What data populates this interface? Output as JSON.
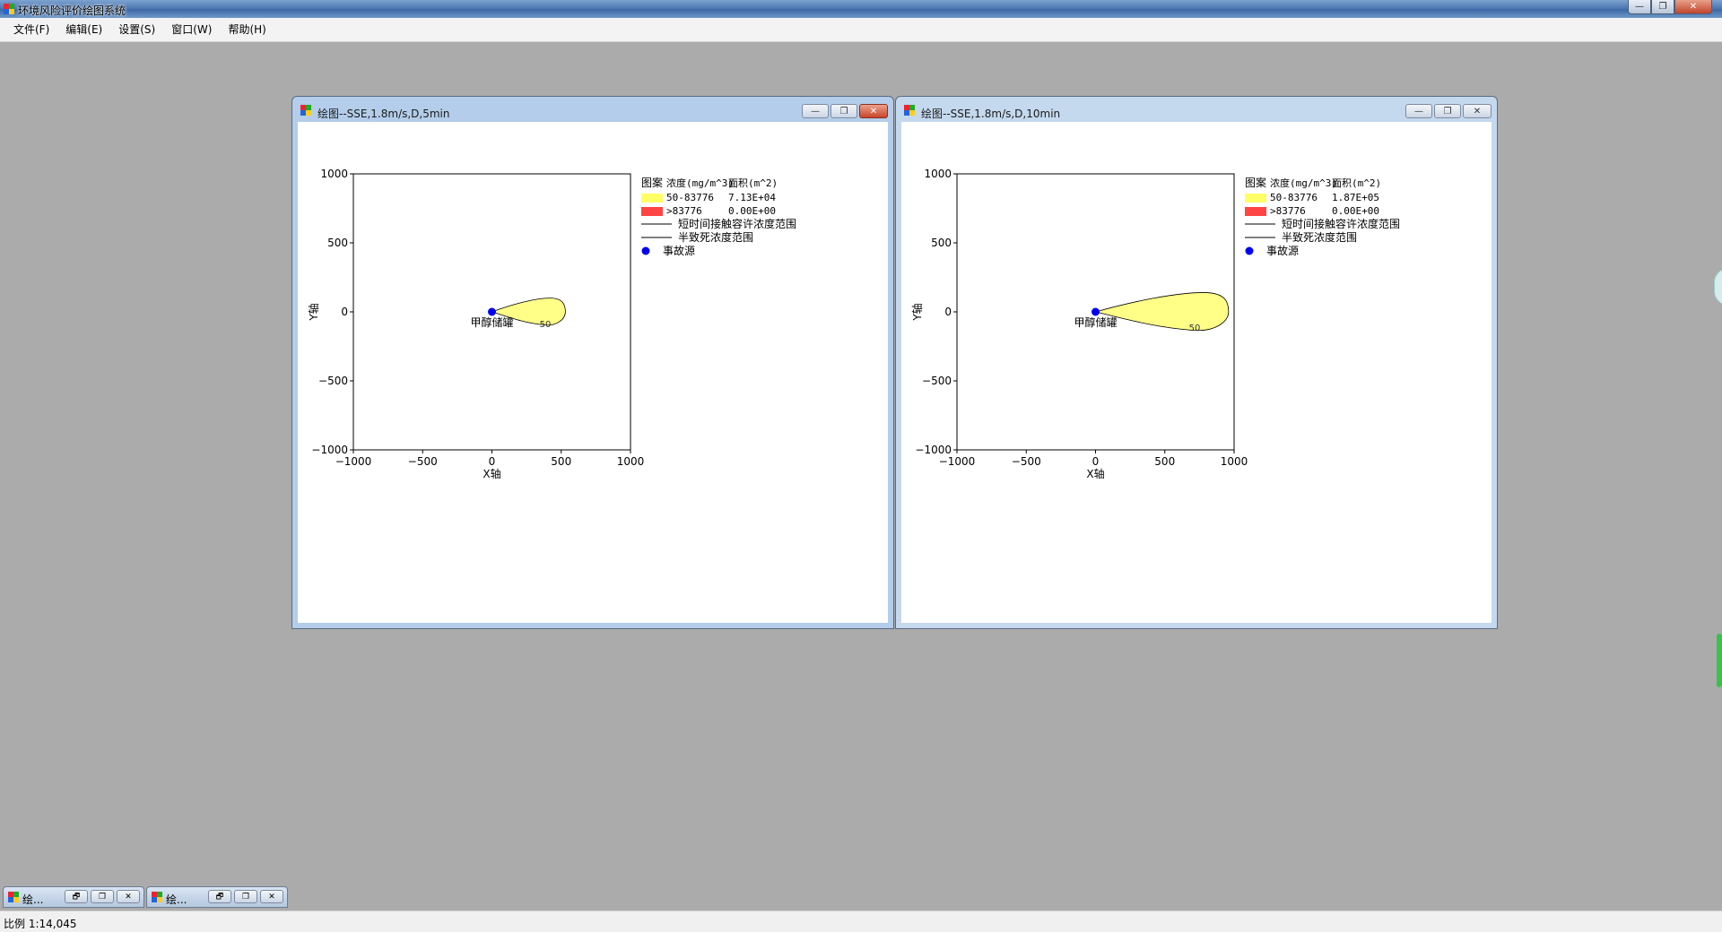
{
  "app": {
    "title": "环境风险评价绘图系统",
    "window_controls": {
      "minimize": "—",
      "restore": "❐",
      "close": "✕"
    }
  },
  "menu": [
    "文件(F)",
    "编辑(E)",
    "设置(S)",
    "窗口(W)",
    "帮助(H)"
  ],
  "windows": [
    {
      "title": "绘图--SSE,1.8m/s,D,5min",
      "active": true,
      "controls": {
        "minimize": "—",
        "restore": "❐",
        "close": "✕"
      }
    },
    {
      "title": "绘图--SSE,1.8m/s,D,10min",
      "active": false,
      "controls": {
        "minimize": "—",
        "restore": "❐",
        "close": "✕"
      }
    }
  ],
  "minimized": [
    {
      "label": "绘...",
      "controls": [
        "🗗",
        "❐",
        "✕"
      ]
    },
    {
      "label": "绘...",
      "controls": [
        "🗗",
        "❐",
        "✕"
      ]
    }
  ],
  "status": {
    "text": "比例 1:14,045"
  },
  "colors": {
    "band_low": "#ffff66",
    "band_high": "#ff4444",
    "source": "#0000ee",
    "plume_fill": "#ffff88"
  },
  "chart_data": [
    {
      "type": "contour",
      "xlabel": "X轴",
      "ylabel": "Y轴",
      "xlim": [
        -1000,
        1000
      ],
      "ylim": [
        -1000,
        1000
      ],
      "xticks": [
        -1000,
        -500,
        0,
        500,
        1000
      ],
      "yticks": [
        -1000,
        -500,
        0,
        500,
        1000
      ],
      "xtick_labels": [
        "−1000",
        "−500",
        "0",
        "500",
        "1000"
      ],
      "ytick_labels": [
        "−1000",
        "−500",
        "0",
        "500",
        "1000"
      ],
      "source": {
        "x": 0,
        "y": 0,
        "label": "甲醇储罐"
      },
      "contour_label": "50",
      "contour_label_at": [
        385,
        -110
      ],
      "plume": {
        "tip_x": 530,
        "half_width": 100,
        "peak_x": 420
      },
      "legend": {
        "headers": [
          "图案",
          "浓度(mg/m^3)",
          "面积(m^2)"
        ],
        "rows": [
          {
            "range": "50-83776",
            "area": "7.13E+04",
            "swatch": "band_low"
          },
          {
            "range": ">83776",
            "area": "0.00E+00",
            "swatch": "band_high"
          }
        ],
        "lines": [
          "短时间接触容许浓度范围",
          "半致死浓度范围"
        ],
        "marker": "事故源"
      }
    },
    {
      "type": "contour",
      "xlabel": "X轴",
      "ylabel": "Y轴",
      "xlim": [
        -1000,
        1000
      ],
      "ylim": [
        -1000,
        1000
      ],
      "xticks": [
        -1000,
        -500,
        0,
        500,
        1000
      ],
      "yticks": [
        -1000,
        -500,
        0,
        500,
        1000
      ],
      "xtick_labels": [
        "−1000",
        "−500",
        "0",
        "500",
        "1000"
      ],
      "ytick_labels": [
        "−1000",
        "−500",
        "0",
        "500",
        "1000"
      ],
      "source": {
        "x": 0,
        "y": 0,
        "label": "甲醇储罐"
      },
      "contour_label": "50",
      "contour_label_at": [
        715,
        -135
      ],
      "plume": {
        "tip_x": 960,
        "half_width": 140,
        "peak_x": 780
      },
      "legend": {
        "headers": [
          "图案",
          "浓度(mg/m^3)",
          "面积(m^2)"
        ],
        "rows": [
          {
            "range": "50-83776",
            "area": "1.87E+05",
            "swatch": "band_low"
          },
          {
            "range": ">83776",
            "area": "0.00E+00",
            "swatch": "band_high"
          }
        ],
        "lines": [
          "短时间接触容许浓度范围",
          "半致死浓度范围"
        ],
        "marker": "事故源"
      }
    }
  ]
}
